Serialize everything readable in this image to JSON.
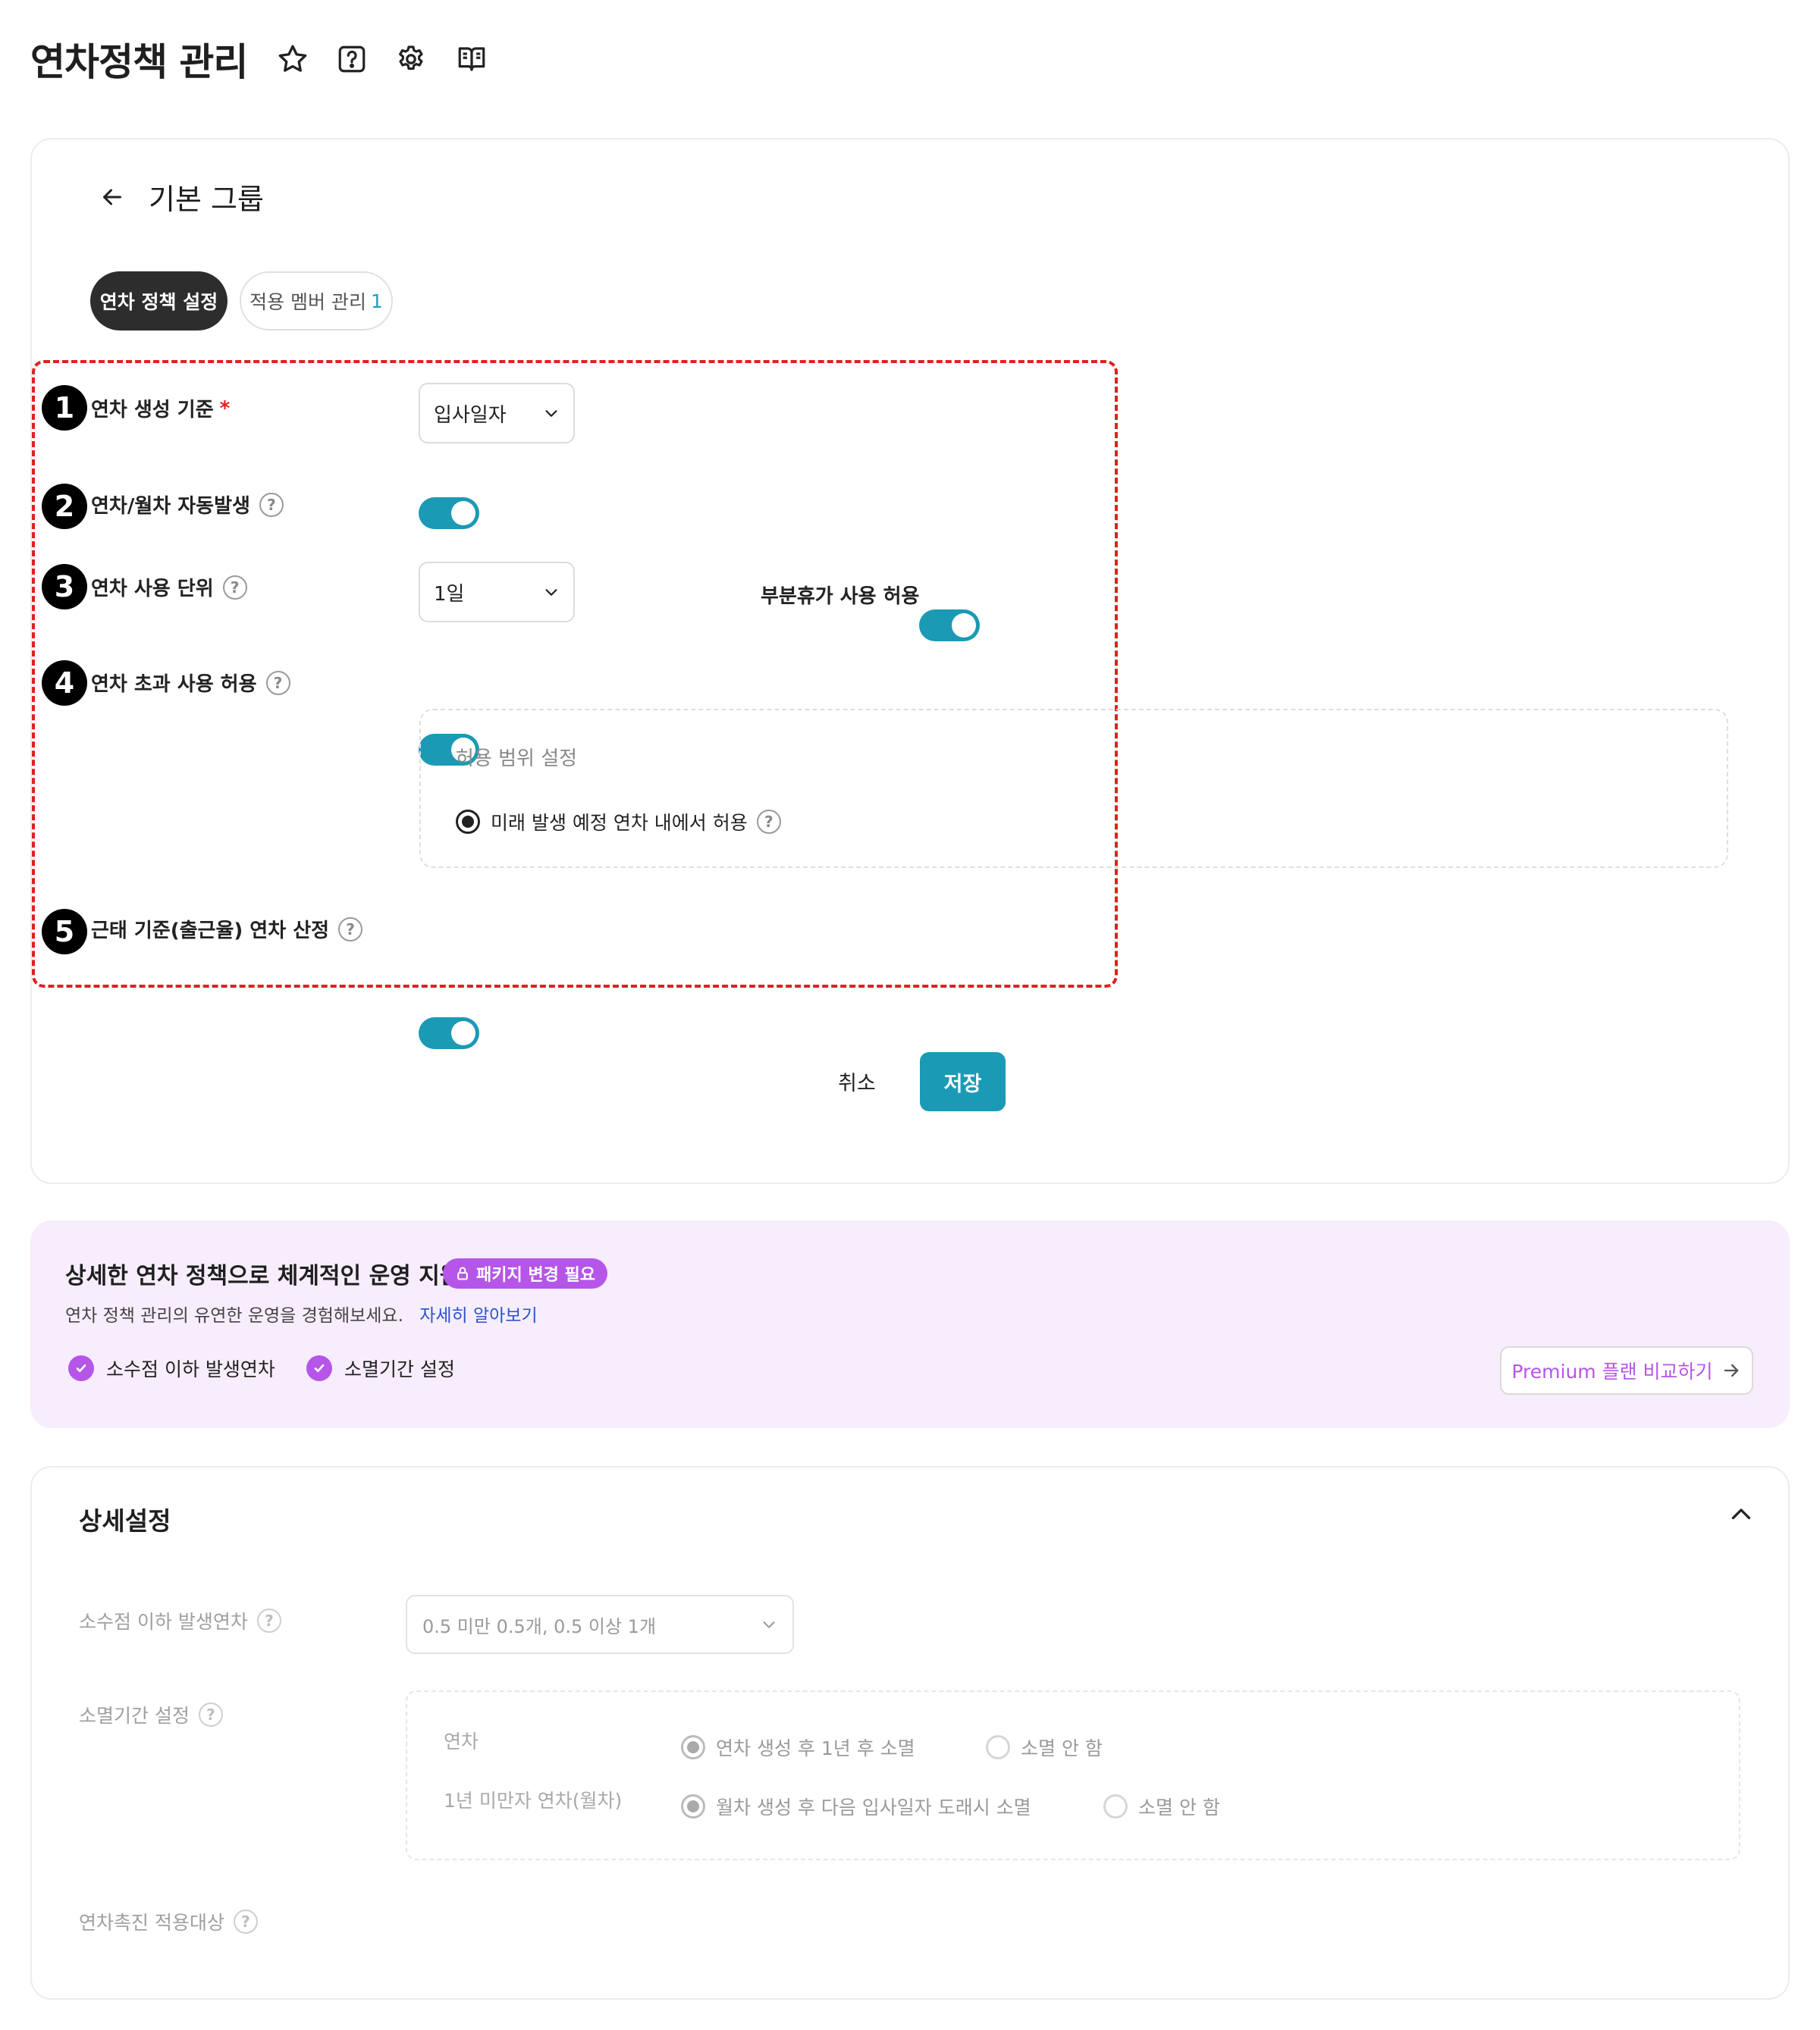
{
  "header": {
    "title": "연차정책 관리",
    "icons": [
      "star-icon",
      "help-box-icon",
      "gear-icon",
      "book-icon"
    ]
  },
  "policy_card": {
    "back_label": "기본 그룹",
    "tabs": [
      {
        "label": "연차 정책 설정",
        "active": true
      },
      {
        "label": "적용 멤버 관리",
        "count": "1",
        "active": false
      }
    ],
    "rows": [
      {
        "badge": "1",
        "label": "연차 생성 기준",
        "required_mark": "*",
        "select_value": "입사일자"
      },
      {
        "badge": "2",
        "label": "연차/월차 자동발생",
        "toggle_on": true
      },
      {
        "badge": "3",
        "label": "연차 사용 단위",
        "select_value": "1일",
        "extra_label": "부분휴가 사용 허용",
        "extra_toggle_on": true
      },
      {
        "badge": "4",
        "label": "연차 초과 사용 허용",
        "toggle_on": true
      },
      {
        "badge": "5",
        "label": "근태 기준(출근율) 연차 산정",
        "toggle_on": true
      }
    ],
    "allowance_box": {
      "title": "허용 범위 설정",
      "option": "미래 발생 예정 연차 내에서 허용",
      "selected": true
    },
    "cancel_label": "취소",
    "save_label": "저장",
    "accent_color": "#1a9ab4"
  },
  "promo": {
    "title": "상세한 연차 정책으로 체계적인 운영 지원",
    "badge": "패키지 변경 필요",
    "description": "연차 정책 관리의 유연한 운영을 경험해보세요.",
    "link": "자세히 알아보기",
    "features": [
      "소수점 이하 발생연차",
      "소멸기간 설정"
    ],
    "button": "Premium 플랜 비교하기",
    "accent_color": "#b556e8",
    "background": "#f7edfd"
  },
  "detail": {
    "title": "상세설정",
    "decimal_label": "소수점 이하 발생연차",
    "decimal_value": "0.5 미만 0.5개, 0.5 이상 1개",
    "expire_label": "소멸기간 설정",
    "expire_rows": [
      {
        "name": "연차",
        "option_selected": "연차 생성 후 1년 후 소멸",
        "option_other": "소멸 안 함"
      },
      {
        "name": "1년 미만자 연차(월차)",
        "option_selected": "월차 생성 후 다음 입사일자 도래시 소멸",
        "option_other": "소멸 안 함"
      }
    ],
    "promotion_label": "연차촉진 적용대상"
  }
}
